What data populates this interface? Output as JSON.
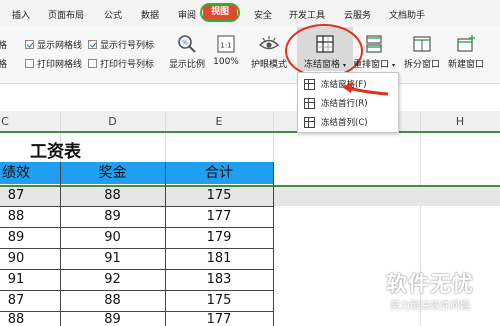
{
  "menu": {
    "tabs": [
      "插入",
      "页面布局",
      "公式",
      "数据",
      "审阅",
      "视图",
      "安全",
      "开发工具",
      "云服务",
      "文档助手"
    ],
    "active": "视图"
  },
  "ribbon": {
    "left_labels": [
      "格",
      "格"
    ],
    "checkboxes": [
      {
        "label": "显示网格线",
        "checked": true
      },
      {
        "label": "显示行号列标",
        "checked": true
      },
      {
        "label": "打印网格线",
        "checked": false
      },
      {
        "label": "打印行号列标",
        "checked": false
      }
    ],
    "buttons": {
      "zoom": "显示比例",
      "zoom100": "100%",
      "eye_mode": "护眼模式",
      "freeze": "冻结窗格",
      "arrange": "重排窗口",
      "split": "拆分窗口",
      "new_window": "新建窗口"
    }
  },
  "freeze_menu": {
    "items": [
      "冻结窗格(F)",
      "冻结首行(R)",
      "冻结首列(C)"
    ]
  },
  "sheet": {
    "columns": [
      "C",
      "D",
      "E",
      "H"
    ],
    "title": "工资表",
    "headers": [
      "绩效",
      "奖金",
      "合计"
    ],
    "rows": [
      [
        "87",
        "88",
        "175"
      ],
      [
        "88",
        "89",
        "177"
      ],
      [
        "89",
        "90",
        "179"
      ],
      [
        "90",
        "91",
        "181"
      ],
      [
        "91",
        "92",
        "183"
      ],
      [
        "87",
        "88",
        "175"
      ],
      [
        "88",
        "89",
        "177"
      ]
    ]
  },
  "watermark": {
    "brand": "软件无忧",
    "slogan": "努力解决软件问题"
  },
  "colors": {
    "active_tab": "#e04a2f",
    "header_fill": "#1e9ff2",
    "freeze_line": "#3f8f3f",
    "highlight": "#e0301e"
  }
}
